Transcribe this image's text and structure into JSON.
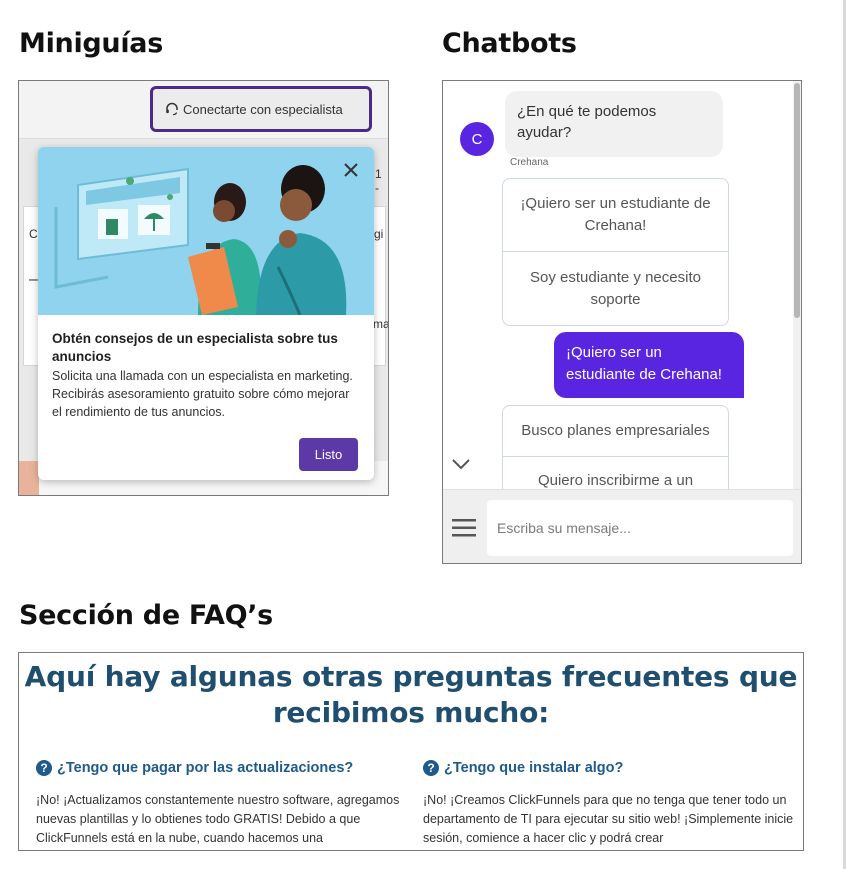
{
  "sections": {
    "miniguias_title": "Miniguías",
    "chatbots_title": "Chatbots",
    "faq_title": "Sección de FAQ’s"
  },
  "miniguia": {
    "connect_button": "Conectarte con especialista",
    "bg_fragments": [
      "1 -",
      "C",
      "gi",
      "–",
      "ma"
    ],
    "tooltip": {
      "title": "Obtén consejos de un especialista sobre tus anuncios",
      "body": "Solicita una llamada con un especialista en marketing. Recibirás asesoramiento gratuito sobre cómo mejorar el rendimiento de tus anuncios.",
      "button": "Listo"
    },
    "accent_color": "#5b3aa8"
  },
  "chatbot": {
    "bot_message": "¿En qué te podemos ayudar?",
    "avatar_letter": "C",
    "bot_name": "Crehana",
    "options_a": [
      "¡Quiero ser un estudiante de Crehana!",
      "Soy estudiante y necesito soporte"
    ],
    "user_message": "¡Quiero ser un estudiante de Crehana!",
    "options_b": [
      "Busco planes empresariales",
      "Quiero inscribirme a un"
    ],
    "input_placeholder": "Escriba su mensaje...",
    "accent_color": "#5a25e0"
  },
  "faq": {
    "heading": "Aquí hay algunas otras preguntas frecuentes que recibimos mucho:",
    "items": [
      {
        "question": "¿Tengo que pagar por las actualizaciones?",
        "answer": "¡No! ¡Actualizamos constantemente nuestro software, agregamos nuevas plantillas y lo obtienes todo GRATIS! Debido a que ClickFunnels está en la nube, cuando hacemos una"
      },
      {
        "question": "¿Tengo que instalar algo?",
        "answer": "¡No! ¡Creamos ClickFunnels para que no tenga que tener todo un departamento de TI para ejecutar su sitio web! ¡Simplemente inicie sesión, comience a hacer clic y podrá crear"
      }
    ],
    "heading_color": "#1f4e6e"
  }
}
